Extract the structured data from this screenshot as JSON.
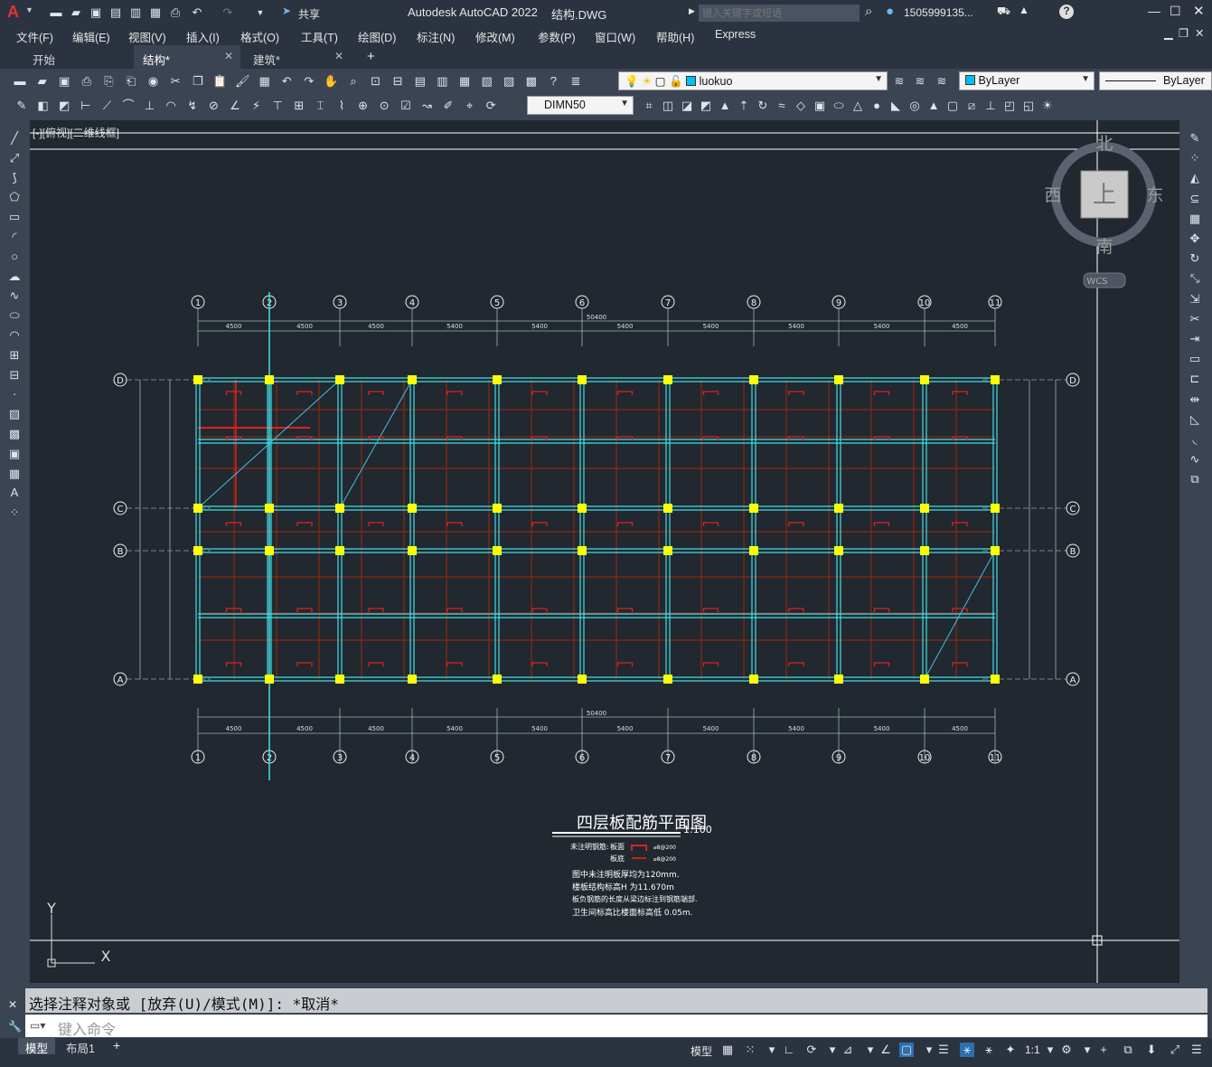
{
  "app": {
    "title": "Autodesk AutoCAD 2022",
    "filename": "结构.DWG",
    "search_placeholder": "键入关键字或短语",
    "user": "1505999135...",
    "share": "共享"
  },
  "menu": [
    "文件(F)",
    "编辑(E)",
    "视图(V)",
    "插入(I)",
    "格式(O)",
    "工具(T)",
    "绘图(D)",
    "标注(N)",
    "修改(M)",
    "参数(P)",
    "窗口(W)",
    "帮助(H)",
    "Express"
  ],
  "tabs": [
    {
      "label": "开始"
    },
    {
      "label": "结构*"
    },
    {
      "label": "建筑*"
    }
  ],
  "toolbar": {
    "layer": "luokuo",
    "color": "ByLayer",
    "linetype": "ByLayer",
    "dimstyle": "DIMN50"
  },
  "viewport_label": "[-][俯视][二维线框]",
  "viewcube": {
    "north": "北",
    "south": "南",
    "east": "东",
    "west": "西",
    "top": "上",
    "wcs": "WCS"
  },
  "drawing": {
    "axis_numbers": [
      "1",
      "2",
      "3",
      "4",
      "5",
      "6",
      "7",
      "8",
      "9",
      "10",
      "11"
    ],
    "axis_letters": [
      "A",
      "B",
      "C",
      "D"
    ],
    "bay_dims": [
      "4500",
      "4500",
      "4500",
      "5400",
      "5400",
      "5400",
      "5400",
      "5400",
      "5400",
      "4500"
    ],
    "total_dim": "50400",
    "title": "四层板配筋平面图",
    "scale": "1:100",
    "legend": {
      "label1": "未注明钢筋:",
      "top": "板面",
      "bottom": "板底",
      "spec": "⌀8@200"
    },
    "notes": [
      "图中未注明板厚均为120mm.",
      "楼板结构标高H 为11.670m",
      "板负钢筋的长度从梁边标注到钢筋端部.",
      "卫生间标高比楼面标高低 0.05m."
    ],
    "ucs": {
      "x": "X",
      "y": "Y"
    }
  },
  "command": {
    "history": "选择注释对象或 [放弃(U)/模式(M)]: *取消*",
    "placeholder": "键入命令"
  },
  "layout_tabs": [
    "模型",
    "布局1"
  ],
  "status": {
    "model": "模型",
    "scale": "1:1"
  }
}
